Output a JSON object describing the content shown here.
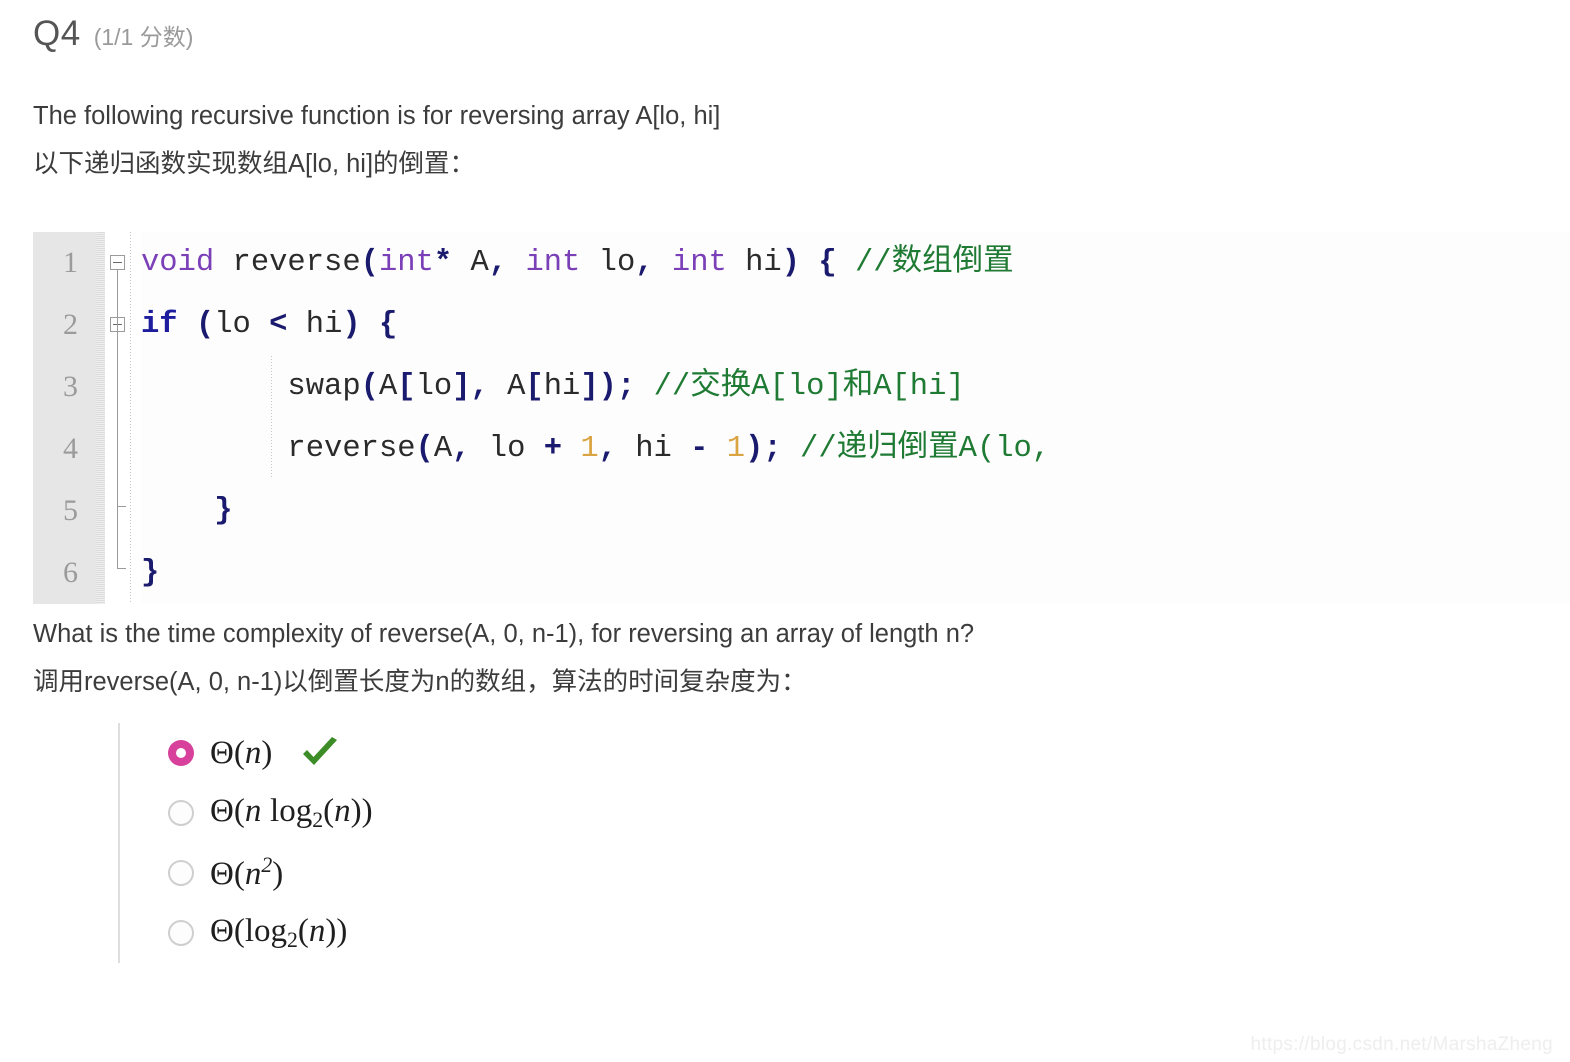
{
  "question": {
    "number": "Q4",
    "score": "(1/1 分数)",
    "prompt_en": "The following recursive function is for reversing array A[lo, hi]",
    "prompt_zh": "以下递归函数实现数组A[lo, hi]的倒置：",
    "ask_en": "What is the time complexity of reverse(A, 0, n-1), for reversing an array of length n?",
    "ask_zh": "调用reverse(A, 0, n-1)以倒置长度为n的数组，算法的时间复杂度为："
  },
  "code": {
    "language": "C++",
    "line_numbers": [
      "1",
      "2",
      "3",
      "4",
      "5",
      "6"
    ],
    "lines": [
      {
        "n": "1",
        "tokens": [
          {
            "t": "void",
            "c": "k"
          },
          {
            "t": " reverse",
            "c": "id"
          },
          {
            "t": "(",
            "c": "p"
          },
          {
            "t": "int",
            "c": "k"
          },
          {
            "t": "*",
            "c": "p"
          },
          {
            "t": " A",
            "c": "id"
          },
          {
            "t": ",",
            "c": "p"
          },
          {
            "t": " ",
            "c": "id"
          },
          {
            "t": "int",
            "c": "k"
          },
          {
            "t": " lo",
            "c": "id"
          },
          {
            "t": ",",
            "c": "p"
          },
          {
            "t": " ",
            "c": "id"
          },
          {
            "t": "int",
            "c": "k"
          },
          {
            "t": " hi",
            "c": "id"
          },
          {
            "t": ")",
            "c": "p"
          },
          {
            "t": " ",
            "c": "id"
          },
          {
            "t": "{",
            "c": "p"
          },
          {
            "t": " //数组倒置",
            "c": "cm"
          }
        ]
      },
      {
        "n": "2",
        "tokens": [
          {
            "t": "if",
            "c": "kw"
          },
          {
            "t": " ",
            "c": "id"
          },
          {
            "t": "(",
            "c": "p"
          },
          {
            "t": "lo ",
            "c": "id"
          },
          {
            "t": "<",
            "c": "p"
          },
          {
            "t": " hi",
            "c": "id"
          },
          {
            "t": ")",
            "c": "p"
          },
          {
            "t": " ",
            "c": "id"
          },
          {
            "t": "{",
            "c": "p"
          }
        ]
      },
      {
        "n": "3",
        "tokens": [
          {
            "t": "        swap",
            "c": "id"
          },
          {
            "t": "(",
            "c": "p"
          },
          {
            "t": "A",
            "c": "id"
          },
          {
            "t": "[",
            "c": "p"
          },
          {
            "t": "lo",
            "c": "id"
          },
          {
            "t": "]",
            "c": "p"
          },
          {
            "t": ",",
            "c": "p"
          },
          {
            "t": " A",
            "c": "id"
          },
          {
            "t": "[",
            "c": "p"
          },
          {
            "t": "hi",
            "c": "id"
          },
          {
            "t": "]",
            "c": "p"
          },
          {
            "t": ")",
            "c": "p"
          },
          {
            "t": ";",
            "c": "p"
          },
          {
            "t": " //交换A[lo]和A[hi]",
            "c": "cm"
          }
        ]
      },
      {
        "n": "4",
        "tokens": [
          {
            "t": "        reverse",
            "c": "id"
          },
          {
            "t": "(",
            "c": "p"
          },
          {
            "t": "A",
            "c": "id"
          },
          {
            "t": ",",
            "c": "p"
          },
          {
            "t": " lo ",
            "c": "id"
          },
          {
            "t": "+",
            "c": "p"
          },
          {
            "t": " ",
            "c": "id"
          },
          {
            "t": "1",
            "c": "num"
          },
          {
            "t": ",",
            "c": "p"
          },
          {
            "t": " hi ",
            "c": "id"
          },
          {
            "t": "-",
            "c": "p"
          },
          {
            "t": " ",
            "c": "id"
          },
          {
            "t": "1",
            "c": "num"
          },
          {
            "t": ")",
            "c": "p"
          },
          {
            "t": ";",
            "c": "p"
          },
          {
            "t": " //递归倒置A(lo,",
            "c": "cm"
          }
        ]
      },
      {
        "n": "5",
        "tokens": [
          {
            "t": "    ",
            "c": "id"
          },
          {
            "t": "}",
            "c": "p"
          }
        ]
      },
      {
        "n": "6",
        "tokens": [
          {
            "t": "}",
            "c": "p"
          }
        ]
      }
    ]
  },
  "options": [
    {
      "id": "opt-a",
      "selected": true,
      "correct": true,
      "text": "Θ(n)"
    },
    {
      "id": "opt-b",
      "selected": false,
      "correct": false,
      "text": "Θ(n log₂(n))"
    },
    {
      "id": "opt-c",
      "selected": false,
      "correct": false,
      "text": "Θ(n²)"
    },
    {
      "id": "opt-d",
      "selected": false,
      "correct": false,
      "text": "Θ(log₂(n))"
    }
  ],
  "feedback": {
    "correct_mark": "✔"
  },
  "watermark": "https://blog.csdn.net/MarshaZheng",
  "colors": {
    "selected_radio": "#d8419b",
    "correct_check": "#3c8c28",
    "keyword_type": "#7b3fb8",
    "keyword_control": "#1d1d9e",
    "punctuation": "#1a1a6e",
    "number_literal": "#d9a441",
    "comment": "#1f7a33",
    "gutter_bg": "#e6e6e6"
  }
}
